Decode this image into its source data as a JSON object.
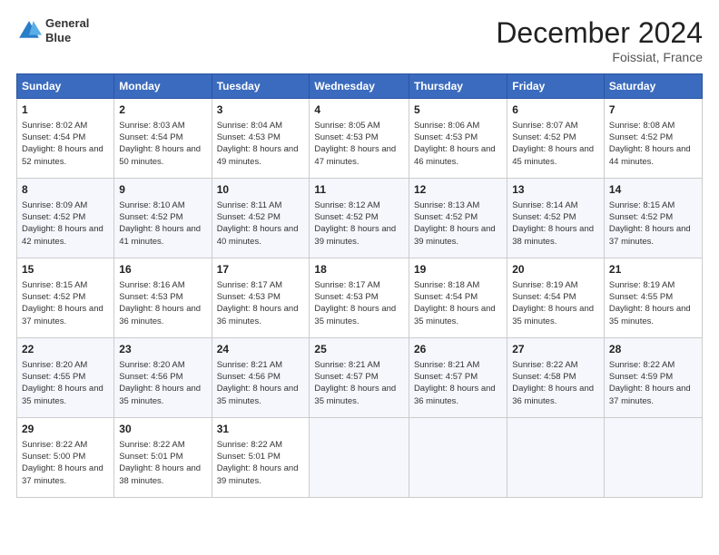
{
  "header": {
    "logo_line1": "General",
    "logo_line2": "Blue",
    "month": "December 2024",
    "location": "Foissiat, France"
  },
  "weekdays": [
    "Sunday",
    "Monday",
    "Tuesday",
    "Wednesday",
    "Thursday",
    "Friday",
    "Saturday"
  ],
  "weeks": [
    [
      {
        "day": 1,
        "sunrise": "8:02 AM",
        "sunset": "4:54 PM",
        "daylight": "8 hours and 52 minutes."
      },
      {
        "day": 2,
        "sunrise": "8:03 AM",
        "sunset": "4:54 PM",
        "daylight": "8 hours and 50 minutes."
      },
      {
        "day": 3,
        "sunrise": "8:04 AM",
        "sunset": "4:53 PM",
        "daylight": "8 hours and 49 minutes."
      },
      {
        "day": 4,
        "sunrise": "8:05 AM",
        "sunset": "4:53 PM",
        "daylight": "8 hours and 47 minutes."
      },
      {
        "day": 5,
        "sunrise": "8:06 AM",
        "sunset": "4:53 PM",
        "daylight": "8 hours and 46 minutes."
      },
      {
        "day": 6,
        "sunrise": "8:07 AM",
        "sunset": "4:52 PM",
        "daylight": "8 hours and 45 minutes."
      },
      {
        "day": 7,
        "sunrise": "8:08 AM",
        "sunset": "4:52 PM",
        "daylight": "8 hours and 44 minutes."
      }
    ],
    [
      {
        "day": 8,
        "sunrise": "8:09 AM",
        "sunset": "4:52 PM",
        "daylight": "8 hours and 42 minutes."
      },
      {
        "day": 9,
        "sunrise": "8:10 AM",
        "sunset": "4:52 PM",
        "daylight": "8 hours and 41 minutes."
      },
      {
        "day": 10,
        "sunrise": "8:11 AM",
        "sunset": "4:52 PM",
        "daylight": "8 hours and 40 minutes."
      },
      {
        "day": 11,
        "sunrise": "8:12 AM",
        "sunset": "4:52 PM",
        "daylight": "8 hours and 39 minutes."
      },
      {
        "day": 12,
        "sunrise": "8:13 AM",
        "sunset": "4:52 PM",
        "daylight": "8 hours and 39 minutes."
      },
      {
        "day": 13,
        "sunrise": "8:14 AM",
        "sunset": "4:52 PM",
        "daylight": "8 hours and 38 minutes."
      },
      {
        "day": 14,
        "sunrise": "8:15 AM",
        "sunset": "4:52 PM",
        "daylight": "8 hours and 37 minutes."
      }
    ],
    [
      {
        "day": 15,
        "sunrise": "8:15 AM",
        "sunset": "4:52 PM",
        "daylight": "8 hours and 37 minutes."
      },
      {
        "day": 16,
        "sunrise": "8:16 AM",
        "sunset": "4:53 PM",
        "daylight": "8 hours and 36 minutes."
      },
      {
        "day": 17,
        "sunrise": "8:17 AM",
        "sunset": "4:53 PM",
        "daylight": "8 hours and 36 minutes."
      },
      {
        "day": 18,
        "sunrise": "8:17 AM",
        "sunset": "4:53 PM",
        "daylight": "8 hours and 35 minutes."
      },
      {
        "day": 19,
        "sunrise": "8:18 AM",
        "sunset": "4:54 PM",
        "daylight": "8 hours and 35 minutes."
      },
      {
        "day": 20,
        "sunrise": "8:19 AM",
        "sunset": "4:54 PM",
        "daylight": "8 hours and 35 minutes."
      },
      {
        "day": 21,
        "sunrise": "8:19 AM",
        "sunset": "4:55 PM",
        "daylight": "8 hours and 35 minutes."
      }
    ],
    [
      {
        "day": 22,
        "sunrise": "8:20 AM",
        "sunset": "4:55 PM",
        "daylight": "8 hours and 35 minutes."
      },
      {
        "day": 23,
        "sunrise": "8:20 AM",
        "sunset": "4:56 PM",
        "daylight": "8 hours and 35 minutes."
      },
      {
        "day": 24,
        "sunrise": "8:21 AM",
        "sunset": "4:56 PM",
        "daylight": "8 hours and 35 minutes."
      },
      {
        "day": 25,
        "sunrise": "8:21 AM",
        "sunset": "4:57 PM",
        "daylight": "8 hours and 35 minutes."
      },
      {
        "day": 26,
        "sunrise": "8:21 AM",
        "sunset": "4:57 PM",
        "daylight": "8 hours and 36 minutes."
      },
      {
        "day": 27,
        "sunrise": "8:22 AM",
        "sunset": "4:58 PM",
        "daylight": "8 hours and 36 minutes."
      },
      {
        "day": 28,
        "sunrise": "8:22 AM",
        "sunset": "4:59 PM",
        "daylight": "8 hours and 37 minutes."
      }
    ],
    [
      {
        "day": 29,
        "sunrise": "8:22 AM",
        "sunset": "5:00 PM",
        "daylight": "8 hours and 37 minutes."
      },
      {
        "day": 30,
        "sunrise": "8:22 AM",
        "sunset": "5:01 PM",
        "daylight": "8 hours and 38 minutes."
      },
      {
        "day": 31,
        "sunrise": "8:22 AM",
        "sunset": "5:01 PM",
        "daylight": "8 hours and 39 minutes."
      },
      null,
      null,
      null,
      null
    ]
  ]
}
